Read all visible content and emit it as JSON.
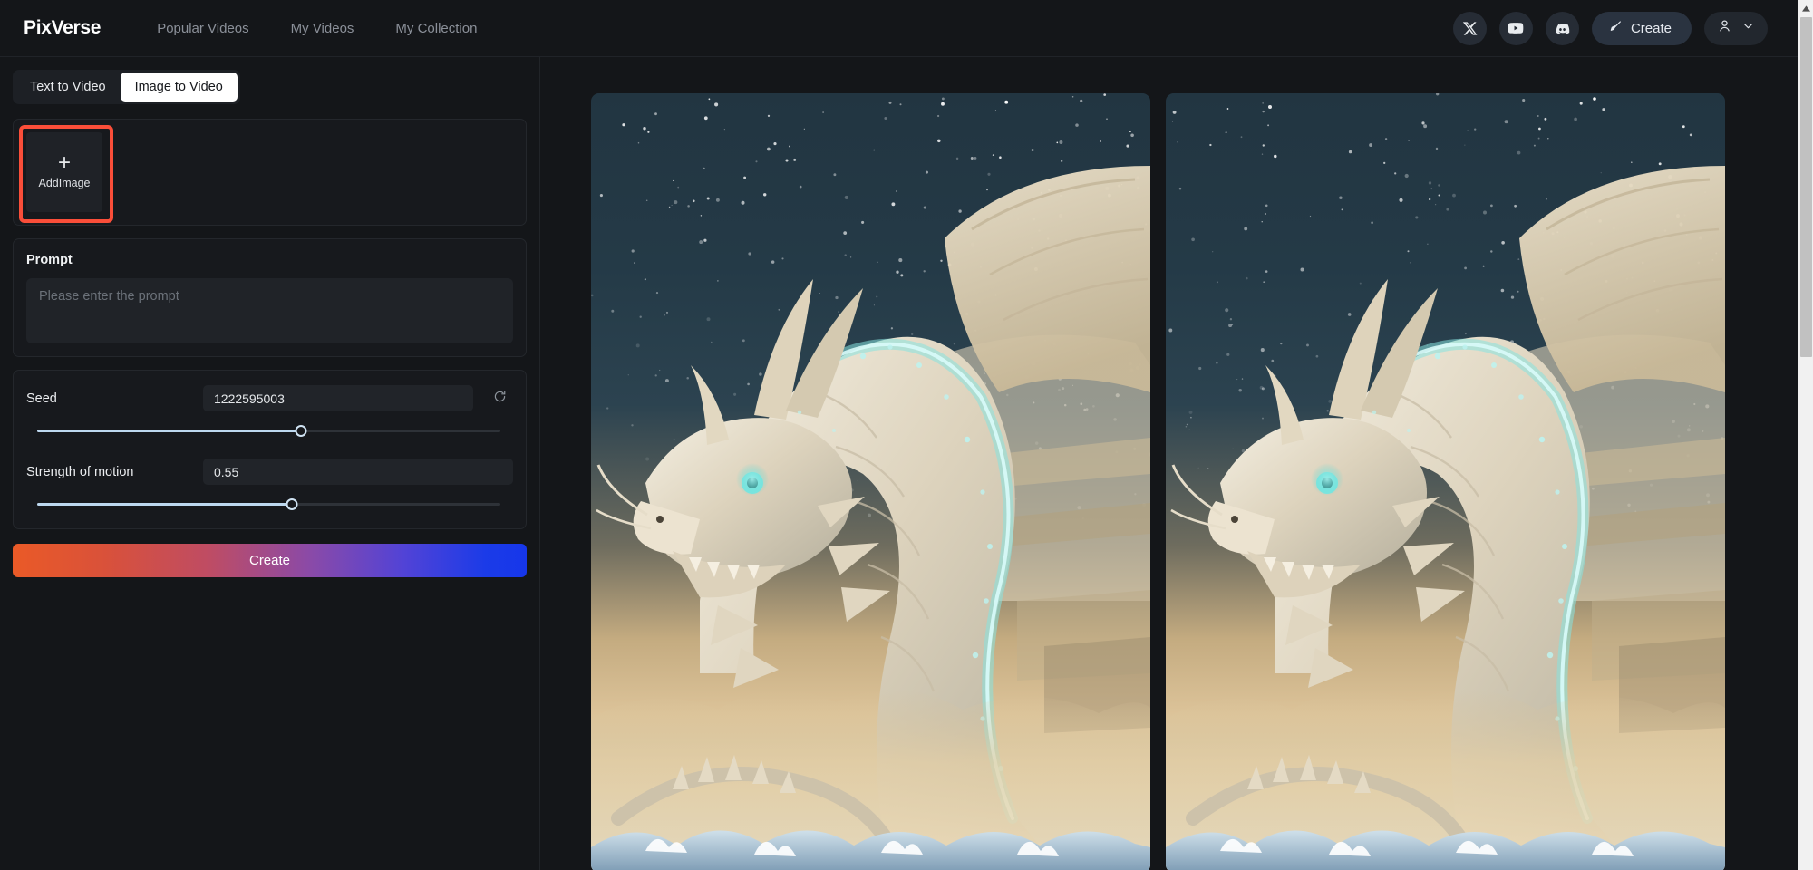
{
  "header": {
    "brand": "PixVerse",
    "nav": [
      {
        "label": "Popular Videos",
        "name": "nav-popular-videos"
      },
      {
        "label": "My Videos",
        "name": "nav-my-videos"
      },
      {
        "label": "My Collection",
        "name": "nav-my-collection"
      }
    ],
    "social": [
      {
        "icon": "x-twitter-icon"
      },
      {
        "icon": "youtube-icon"
      },
      {
        "icon": "discord-icon"
      }
    ],
    "create_label": "Create",
    "create_icon": "brush-icon",
    "account_icon": "user-icon",
    "account_chevron_icon": "chevron-down-icon"
  },
  "left_panel": {
    "tabs": [
      {
        "label": "Text to Video",
        "active": false
      },
      {
        "label": "Image to Video",
        "active": true
      }
    ],
    "add_image": {
      "label": "AddImage",
      "plus_icon": "plus-icon",
      "highlighted": true,
      "highlight_color": "#fa4e39"
    },
    "prompt": {
      "label": "Prompt",
      "value": "",
      "placeholder": "Please enter the prompt"
    },
    "params": [
      {
        "name": "Seed",
        "value": "1222595003",
        "slider_percent": 57,
        "has_refresh": true,
        "refresh_icon": "refresh-icon"
      },
      {
        "name": "Strength of motion",
        "value": "0.55",
        "slider_percent": 55,
        "has_refresh": false
      }
    ],
    "create_button": {
      "label": "Create",
      "gradient_from": "#ea5a27",
      "gradient_to": "#1b3be8"
    }
  },
  "main": {
    "results": [
      {
        "name": "result-image-1",
        "alt": "Ivory Chinese dragon with glowing cyan scales over a starry night sky and golden clouds"
      },
      {
        "name": "result-image-2",
        "alt": "Ivory Chinese dragon with glowing cyan scales over a starry night sky and golden clouds"
      }
    ]
  },
  "scrollbar": {
    "up_arrow_icon": "chevron-up-icon",
    "thumb_top_percent": 2,
    "thumb_height_percent": 39
  },
  "colors": {
    "app_background": "#141619",
    "panel_background": "#17191d",
    "accent_highlight": "#fa4e39",
    "slider_fill": "#bdd8ef",
    "tab_active_bg": "#ffffff"
  }
}
